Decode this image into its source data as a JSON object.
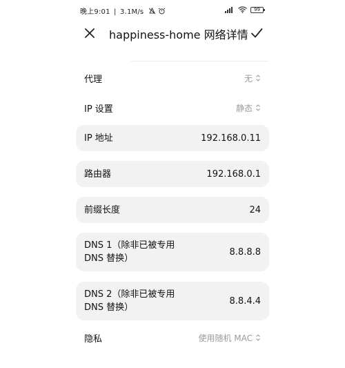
{
  "status_bar": {
    "time": "晚上9:01",
    "separator": "|",
    "speed": "3.1M/s",
    "battery": "99"
  },
  "header": {
    "title": "happiness-home 网络详情"
  },
  "settings": {
    "proxy": {
      "label": "代理",
      "value": "无"
    },
    "ip_setting": {
      "label": "IP 设置",
      "value": "静态"
    },
    "ip_address": {
      "label": "IP 地址",
      "value": "192.168.0.11"
    },
    "router": {
      "label": "路由器",
      "value": "192.168.0.1"
    },
    "prefix_length": {
      "label": "前缀长度",
      "value": "24"
    },
    "dns1": {
      "label_line1": "DNS 1（除非已被专用",
      "label_line2": "DNS 替换）",
      "value": "8.8.8.8"
    },
    "dns2": {
      "label_line1": "DNS 2（除非已被专用",
      "label_line2": "DNS 替换）",
      "value": "8.8.4.4"
    },
    "privacy": {
      "label": "隐私",
      "value": "使用随机 MAC"
    }
  }
}
